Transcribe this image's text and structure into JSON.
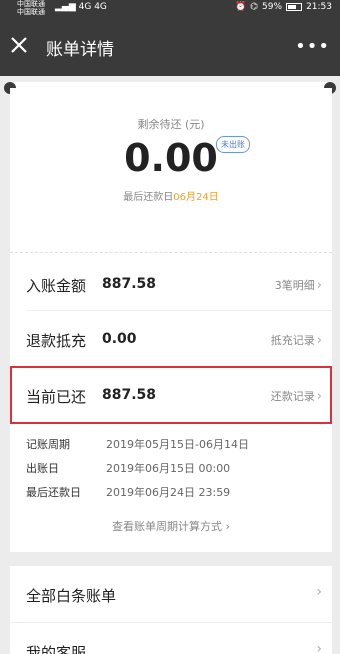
{
  "status_bar": {
    "carrier_1": "中国联通",
    "carrier_2": "中国联通",
    "network_1": "4G",
    "network_2": "4G",
    "battery": "59%",
    "time": "21:53"
  },
  "header": {
    "title": "账单详情",
    "close_icon": "close-icon",
    "more_icon": "more-icon"
  },
  "summary": {
    "label": "剩余待还 (元)",
    "amount": "0.00",
    "badge": "未出账",
    "due_prefix": "最后还款日",
    "due_date": "06月24日"
  },
  "rows": [
    {
      "label": "入账金额",
      "value": "887.58",
      "link": "3笔明细"
    },
    {
      "label": "退款抵充",
      "value": "0.00",
      "link": "抵充记录"
    },
    {
      "label": "当前已还",
      "value": "887.58",
      "link": "还款记录"
    }
  ],
  "details": [
    {
      "label": "记账周期",
      "value": "2019年05月15日-06月14日"
    },
    {
      "label": "出账日",
      "value": "2019年06月15日 00:00"
    },
    {
      "label": "最后还款日",
      "value": "2019年06月24日 23:59"
    }
  ],
  "calc_link": "查看账单周期计算方式",
  "menu": [
    {
      "label": "全部白条账单"
    },
    {
      "label": "我的客服"
    }
  ],
  "colors": {
    "accent": "#f0a030",
    "highlight": "#d8323c",
    "header": "#3a3a3a"
  }
}
